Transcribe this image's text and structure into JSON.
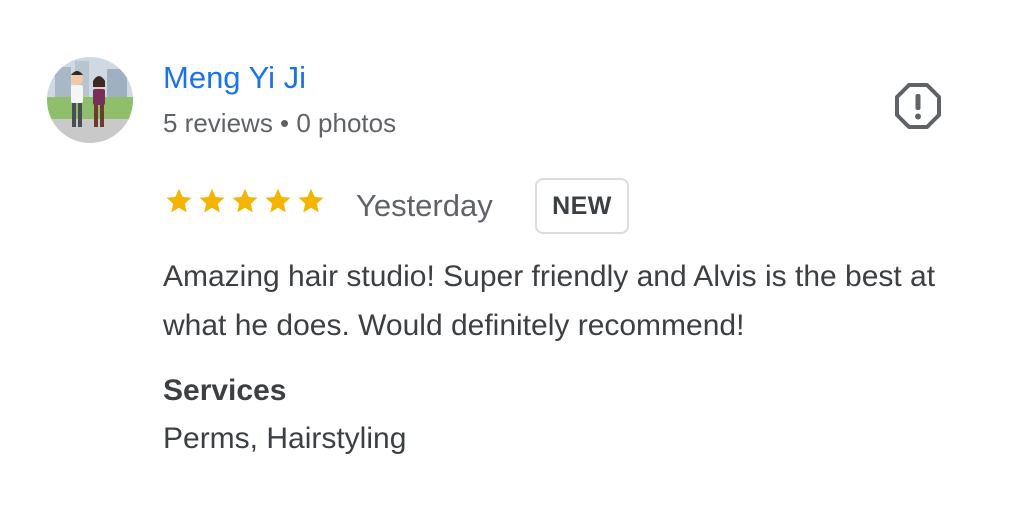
{
  "review": {
    "author": {
      "name": "Meng Yi Ji",
      "meta": "5 reviews • 0 photos",
      "avatar_icon": "user-avatar-photo"
    },
    "report_icon": "report-octagon-exclamation-icon",
    "rating": 5,
    "rating_max": 5,
    "date": "Yesterday",
    "badge": "NEW",
    "text": "Amazing hair studio! Super friendly and Alvis is the best at what he does. Would definitely recommend!",
    "services": {
      "label": "Services",
      "value": "Perms, Hairstyling"
    }
  },
  "colors": {
    "author_link": "#1a73e8",
    "star": "#f4b400",
    "secondary_text": "#5f6368",
    "primary_text": "#3c4043",
    "badge_border": "#dadce0"
  }
}
